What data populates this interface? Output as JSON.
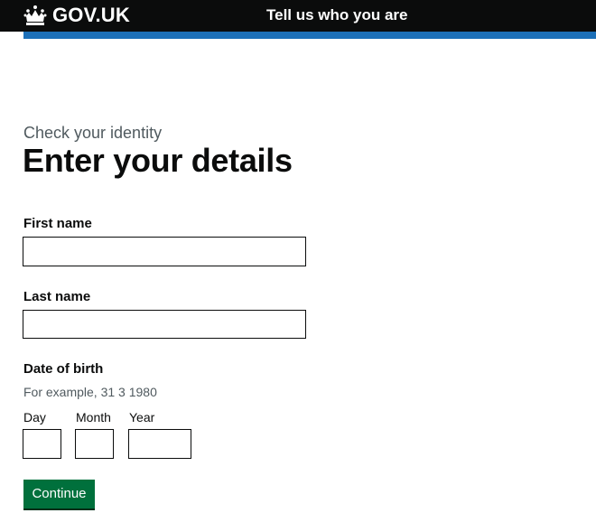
{
  "header": {
    "logo_text": "GOV.UK",
    "service_name": "Tell us who you are",
    "logo_icon": "crown-icon",
    "colors": {
      "header_bg": "#0b0c0c",
      "stripe": "#1d70b8"
    }
  },
  "main": {
    "caption": "Check your identity",
    "heading": "Enter your details",
    "first_name": {
      "label": "First name",
      "value": ""
    },
    "last_name": {
      "label": "Last name",
      "value": ""
    },
    "dob": {
      "label": "Date of birth",
      "hint": "For example, 31 3 1980",
      "day_label": "Day",
      "month_label": "Month",
      "year_label": "Year",
      "day_value": "",
      "month_value": "",
      "year_value": ""
    },
    "continue_label": "Continue",
    "colors": {
      "button": "#00703c",
      "hint_text": "#505a5f"
    }
  }
}
